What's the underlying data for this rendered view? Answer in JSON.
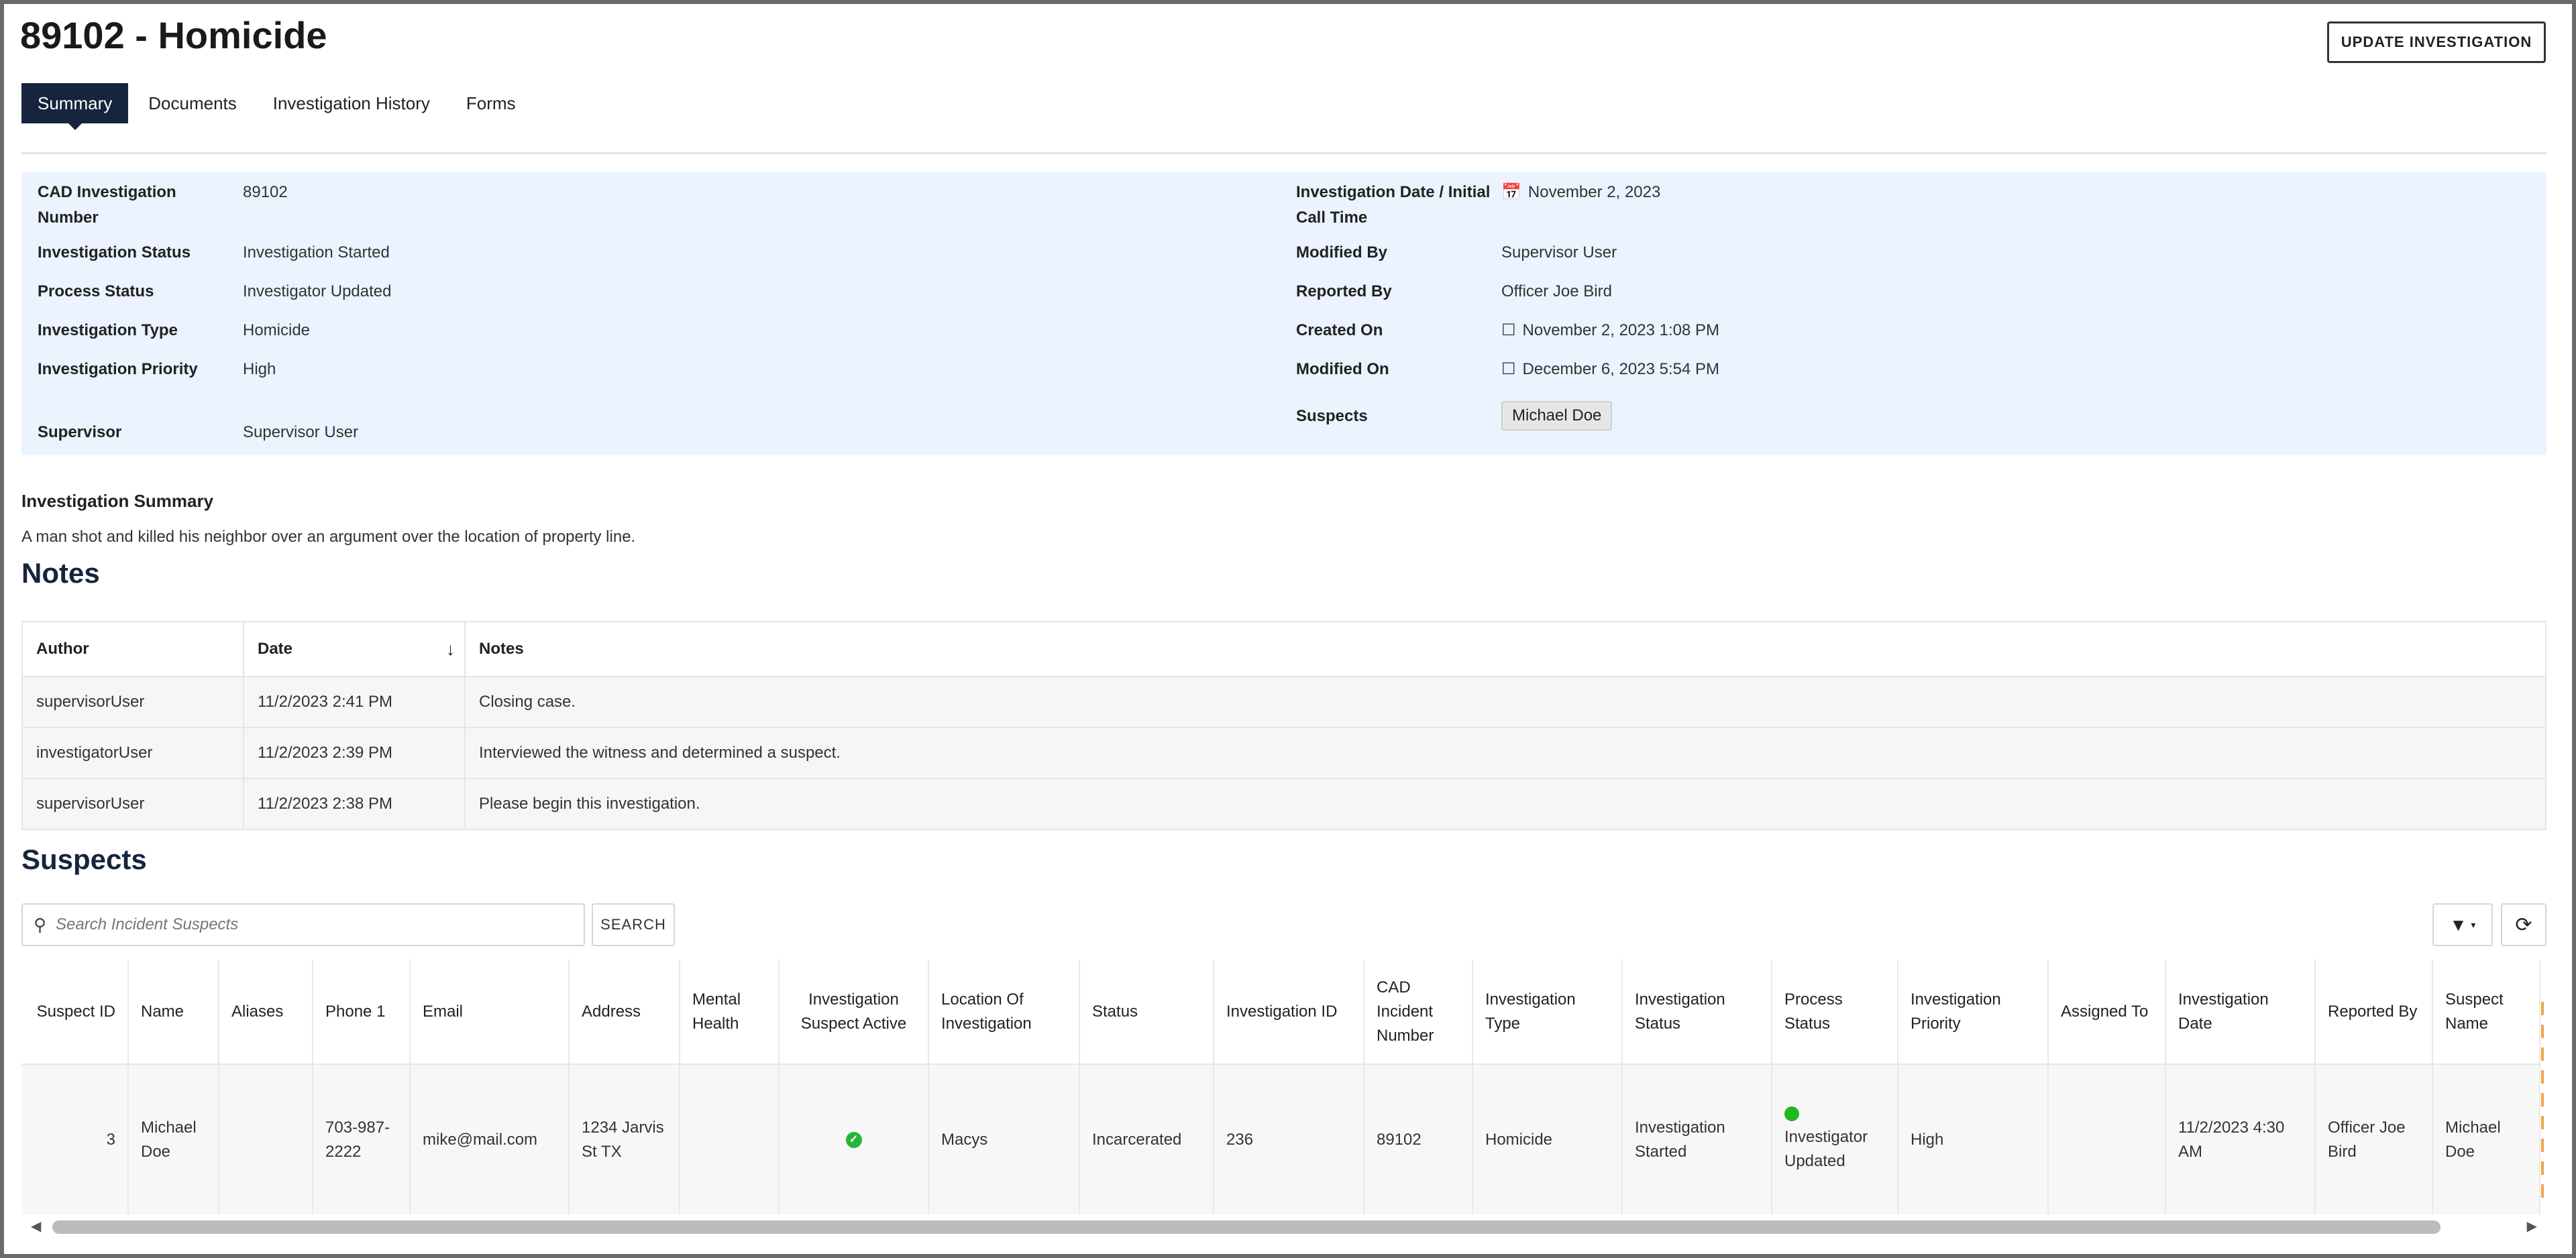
{
  "header": {
    "title": "89102 - Homicide",
    "update_button": "UPDATE INVESTIGATION"
  },
  "tabs": [
    {
      "label": "Summary",
      "active": true
    },
    {
      "label": "Documents",
      "active": false
    },
    {
      "label": "Investigation History",
      "active": false
    },
    {
      "label": "Forms",
      "active": false
    }
  ],
  "summary_left": [
    {
      "label": "CAD Investigation Number",
      "value": "89102"
    },
    {
      "label": "Investigation Status",
      "value": "Investigation Started"
    },
    {
      "label": "Process Status",
      "value": "Investigator Updated"
    },
    {
      "label": "Investigation Type",
      "value": "Homicide"
    },
    {
      "label": "Investigation Priority",
      "value": "High"
    },
    {
      "label": "Supervisor",
      "value": "Supervisor User"
    }
  ],
  "summary_right": [
    {
      "label": "Investigation Date / Initial Call Time",
      "value": "November 2, 2023",
      "icon": "calendar-icon"
    },
    {
      "label": "Modified By",
      "value": "Supervisor User"
    },
    {
      "label": "Reported By",
      "value": "Officer Joe Bird"
    },
    {
      "label": "Created On",
      "value": "November 2, 2023 1:08 PM",
      "icon": "calendar-icon"
    },
    {
      "label": "Modified On",
      "value": "December 6, 2023 5:54 PM",
      "icon": "calendar-icon"
    },
    {
      "label": "Suspects",
      "chip": "Michael Doe"
    }
  ],
  "investigation_summary": {
    "label": "Investigation Summary",
    "text": "A man shot and killed his neighbor over an argument over the location of property line."
  },
  "notes": {
    "title": "Notes",
    "columns": [
      "Author",
      "Date",
      "Notes"
    ],
    "rows": [
      [
        "supervisorUser",
        "11/2/2023 2:41 PM",
        "Closing case."
      ],
      [
        "investigatorUser",
        "11/2/2023 2:39 PM",
        "Interviewed the witness and determined a suspect."
      ],
      [
        "supervisorUser",
        "11/2/2023 2:38 PM",
        "Please begin this investigation."
      ]
    ]
  },
  "suspects": {
    "title": "Suspects",
    "search_placeholder": "Search Incident Suspects",
    "search_button": "SEARCH",
    "columns": [
      "Suspect ID",
      "Name",
      "Aliases",
      "Phone 1",
      "Email",
      "Address",
      "Mental Health",
      "Investigation Suspect Active",
      "Location Of Investigation",
      "Status",
      "Investigation ID",
      "CAD Incident Number",
      "Investigation Type",
      "Investigation Status",
      "Process Status",
      "Investigation Priority",
      "Assigned To",
      "Investigation Date",
      "Reported By",
      "Suspect Name"
    ],
    "row": {
      "suspect_id": "3",
      "name": "Michael Doe",
      "aliases": "",
      "phone": "703-987-2222",
      "email": "mike@mail.com",
      "address": "1234 Jarvis St TX",
      "mental_health": "",
      "location": "Macys",
      "status": "Incarcerated",
      "investigation_id": "236",
      "cad_number": "89102",
      "type": "Homicide",
      "inv_status": "Investigation Started",
      "process_status": "Investigator Updated",
      "priority": "High",
      "assigned_to": "",
      "inv_date": "11/2/2023 4:30 AM",
      "reported_by": "Officer Joe Bird",
      "suspect_name": "Michael Doe"
    }
  },
  "colors": {
    "accent": "#17243d",
    "summary_bg": "#eaf3fe",
    "active_status": "#28b43c"
  }
}
